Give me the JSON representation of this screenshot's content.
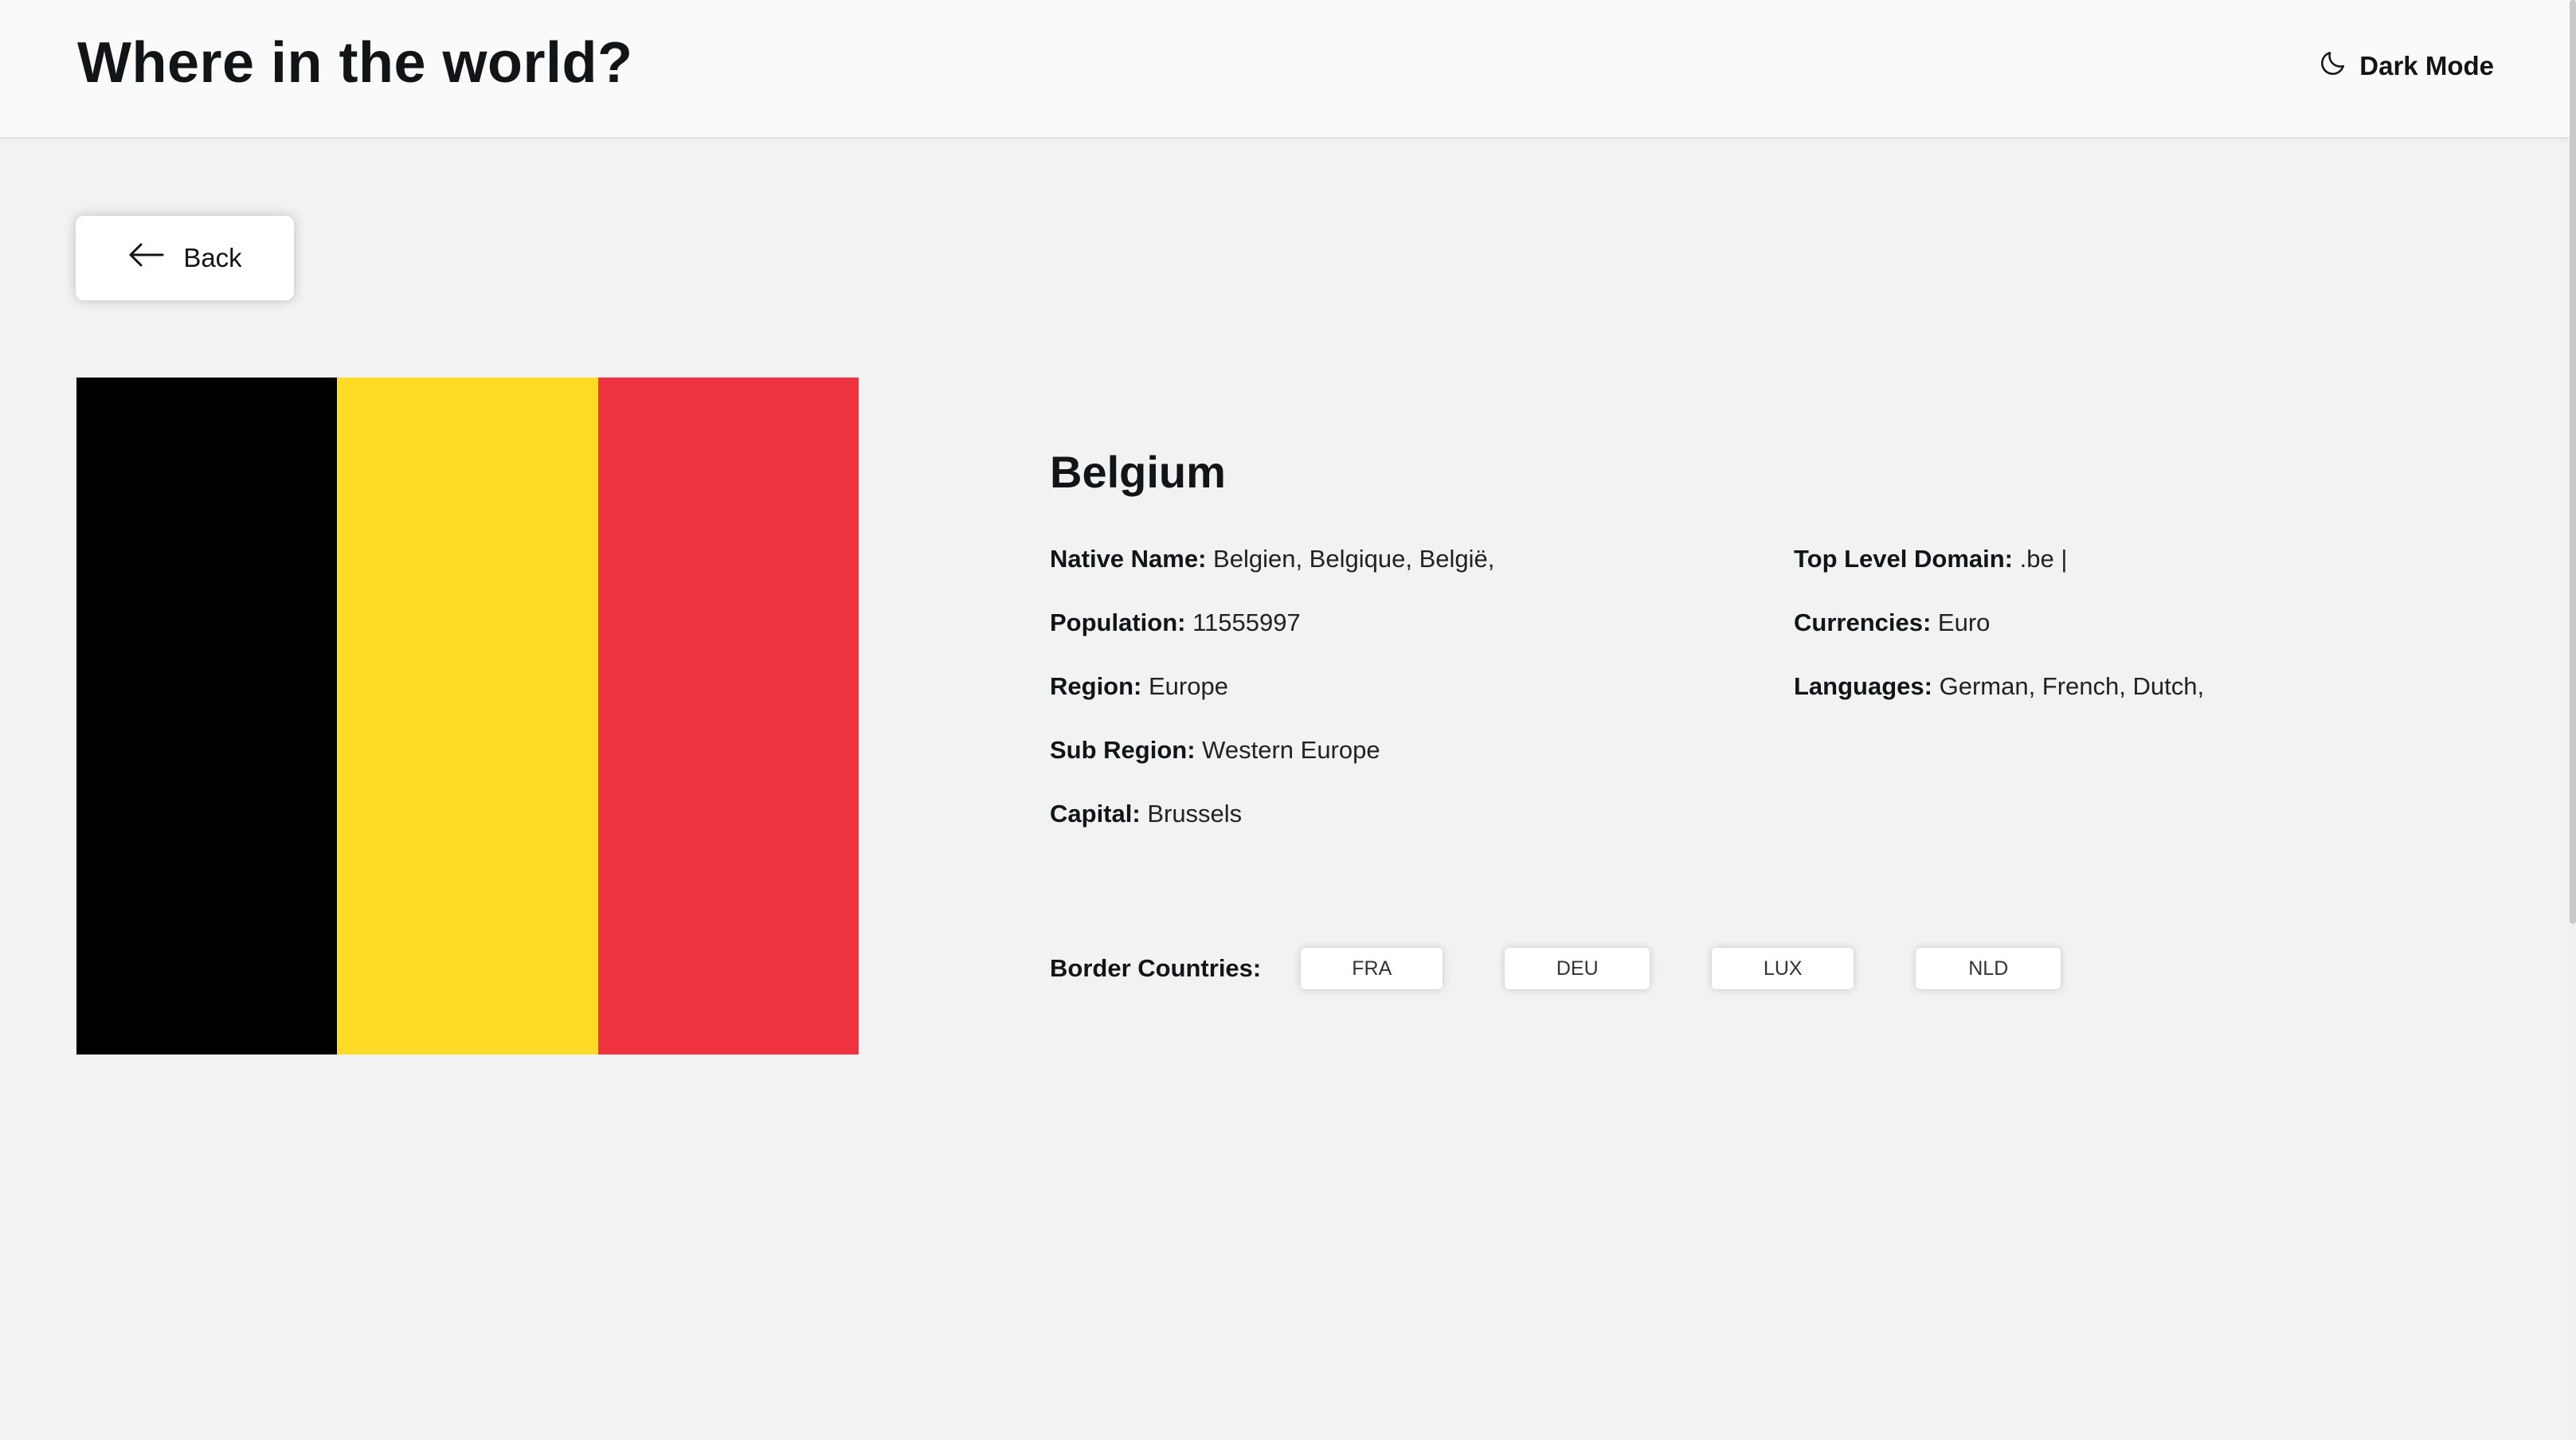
{
  "header": {
    "title": "Where in the world?",
    "theme_toggle_label": "Dark Mode",
    "theme_toggle_icon": "moon-icon"
  },
  "back_button": {
    "label": "Back",
    "icon": "arrow-left-icon"
  },
  "country": {
    "name": "Belgium",
    "flag_colors": [
      "#000000",
      "#fdda24",
      "#ef3340"
    ],
    "left_column": [
      {
        "label": "Native Name:",
        "value": "Belgien, Belgique, België,"
      },
      {
        "label": "Population:",
        "value": "11555997"
      },
      {
        "label": "Region:",
        "value": "Europe"
      },
      {
        "label": "Sub Region:",
        "value": "Western Europe"
      },
      {
        "label": "Capital:",
        "value": "Brussels"
      }
    ],
    "right_column": [
      {
        "label": "Top Level Domain:",
        "value": ".be |"
      },
      {
        "label": "Currencies:",
        "value": "Euro"
      },
      {
        "label": "Languages:",
        "value": "German, French, Dutch,"
      }
    ],
    "border_countries_label": "Border Countries:",
    "border_countries": [
      "FRA",
      "DEU",
      "LUX",
      "NLD"
    ]
  }
}
